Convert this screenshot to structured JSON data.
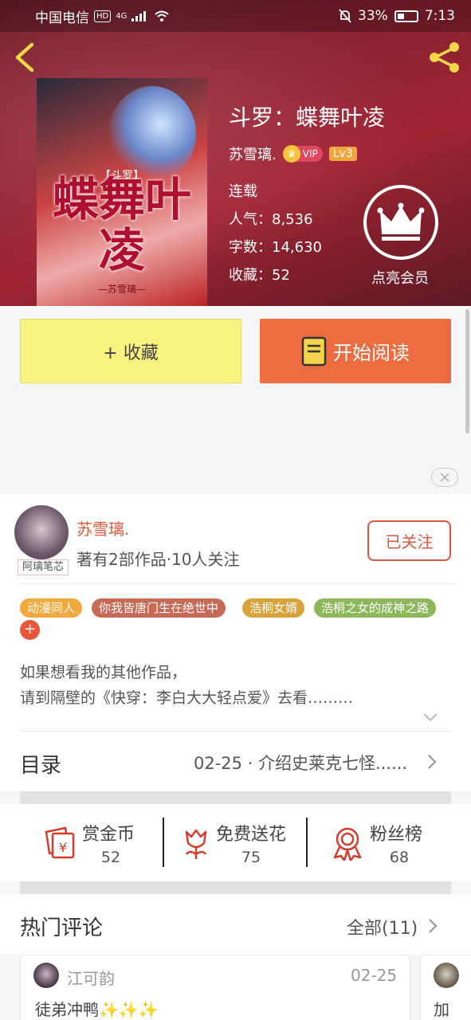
{
  "status_bar": {
    "carrier": "中国电信",
    "hd": "HD",
    "network": "4G",
    "battery": "33%",
    "time": "7:13"
  },
  "book": {
    "title": "斗罗：蝶舞叶凌",
    "author": "苏雪璃.",
    "vip_label": "VIP",
    "level": "Lv3",
    "serial_status": "连载",
    "popularity_label": "人气：8,536",
    "words_label": "字数：14,630",
    "favorites_label": "收藏：52",
    "cover": {
      "series_tag": "【斗罗】",
      "title_art": "蝶舞叶凌",
      "author_art": "—苏雪璃—"
    }
  },
  "member": {
    "label": "点亮会员"
  },
  "actions": {
    "favorite_label": "+ 收藏",
    "read_label": "开始阅读"
  },
  "author_card": {
    "name": "苏雪璃.",
    "meta": "著有2部作品·10人关注",
    "badge": "阿璃笔芯",
    "follow_label": "已关注"
  },
  "tags": [
    "动漫同人",
    "你我皆唐门生在绝世中",
    "浩桐女婿",
    "浩桐之女的成神之路"
  ],
  "tag_add": "+",
  "synopsis": {
    "line1": "如果想看我的其他作品，",
    "line2": "请到隔壁的《快穿：李白大大轻点爱》去看………"
  },
  "toc": {
    "label": "目录",
    "latest": "02-25 · 介绍史莱克七怪......"
  },
  "rewards": [
    {
      "title": "赏金币",
      "count": "52",
      "icon": "red-envelope-icon"
    },
    {
      "title": "免费送花",
      "count": "75",
      "icon": "flower-icon"
    },
    {
      "title": "粉丝榜",
      "count": "68",
      "icon": "medal-icon"
    }
  ],
  "comments": {
    "title": "热门评论",
    "all_label": "全部(11)",
    "items": [
      {
        "user": "江可韵",
        "date": "02-25",
        "text": "徒弟冲鸭✨✨✨"
      },
      {
        "text": "加"
      }
    ]
  },
  "colors": {
    "accent_orange": "#ec6b3f",
    "favorite_yellow": "#f8f27e",
    "author_red": "#e0563a",
    "hero_red": "#8b2230"
  }
}
